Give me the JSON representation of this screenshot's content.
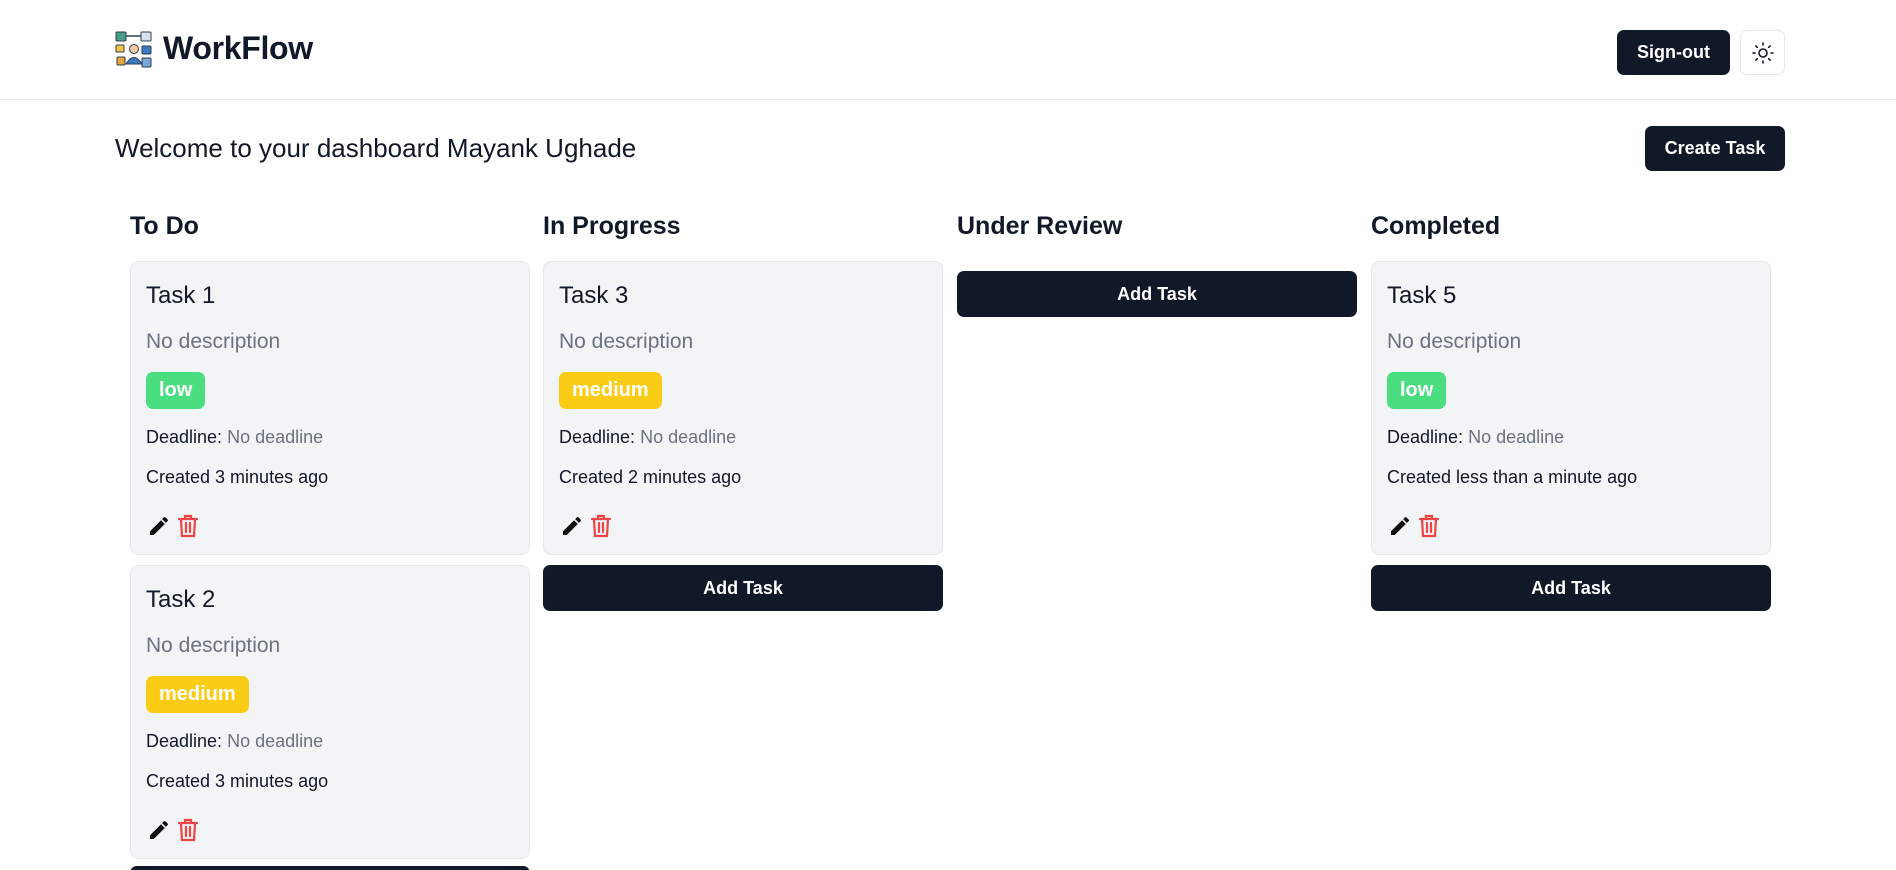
{
  "header": {
    "app_name": "WorkFlow",
    "signout_label": "Sign-out",
    "theme_icon": "sun-icon"
  },
  "main": {
    "welcome": "Welcome to your dashboard Mayank Ughade",
    "create_task_label": "Create Task"
  },
  "colors": {
    "primary": "#111827",
    "card_bg": "#f3f4f6",
    "low": "#4ade80",
    "medium": "#facc15",
    "danger": "#ef4444",
    "muted": "#6b7280"
  },
  "board": {
    "add_task_label": "Add Task",
    "deadline_label": "Deadline:",
    "columns": [
      {
        "title": "To Do",
        "tasks": [
          {
            "title": "Task 1",
            "description": "No description",
            "priority": "low",
            "deadline": "No deadline",
            "created": "Created 3 minutes ago"
          },
          {
            "title": "Task 2",
            "description": "No description",
            "priority": "medium",
            "deadline": "No deadline",
            "created": "Created 3 minutes ago"
          }
        ]
      },
      {
        "title": "In Progress",
        "tasks": [
          {
            "title": "Task 3",
            "description": "No description",
            "priority": "medium",
            "deadline": "No deadline",
            "created": "Created 2 minutes ago"
          }
        ]
      },
      {
        "title": "Under Review",
        "tasks": []
      },
      {
        "title": "Completed",
        "tasks": [
          {
            "title": "Task 5",
            "description": "No description",
            "priority": "low",
            "deadline": "No deadline",
            "created": "Created less than a minute ago"
          }
        ]
      }
    ]
  }
}
